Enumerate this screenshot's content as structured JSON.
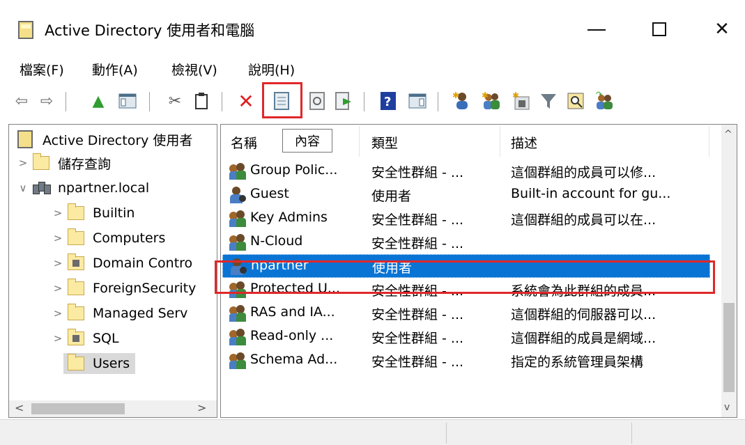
{
  "window": {
    "title": "Active Directory 使用者和電腦",
    "minimize": "—",
    "maximize": "☐",
    "close": "✕"
  },
  "menu": [
    {
      "label": "檔案(F)"
    },
    {
      "label": "動作(A)"
    },
    {
      "label": "檢視(V)"
    },
    {
      "label": "說明(H)"
    }
  ],
  "toolbar": {
    "icons": [
      "back-icon",
      "forward-icon",
      "up-folder-icon",
      "show-tree-icon",
      "cut-icon",
      "copy-icon",
      "delete-icon",
      "properties-icon",
      "refresh-icon",
      "export-list-icon",
      "help-icon",
      "action-pane-icon",
      "new-user-icon",
      "new-group-icon",
      "new-ou-icon",
      "filter-icon",
      "find-icon",
      "add-to-group-icon"
    ],
    "highlighted": "properties-icon",
    "highlight_color": "#e0282a"
  },
  "tree": {
    "root": "Active Directory 使用者",
    "items": [
      {
        "label": "儲存查詢"
      },
      {
        "label": "npartner.local"
      },
      {
        "label": "Builtin"
      },
      {
        "label": "Computers"
      },
      {
        "label": "Domain Contro"
      },
      {
        "label": "ForeignSecurity"
      },
      {
        "label": "Managed Serv"
      },
      {
        "label": "SQL"
      },
      {
        "label": "Users"
      }
    ],
    "selected": "Users"
  },
  "list": {
    "columns": {
      "name": "名稱",
      "type": "類型",
      "desc": "描述"
    },
    "tooltip": "內容",
    "rows": [
      {
        "name": "Group Polic...",
        "type": "安全性群組 - ...",
        "desc": "這個群組的成員可以修...",
        "icon": "group-icon"
      },
      {
        "name": "Guest",
        "type": "使用者",
        "desc": "Built-in account for gu...",
        "icon": "user-icon"
      },
      {
        "name": "Key Admins",
        "type": "安全性群組 - ...",
        "desc": "這個群組的成員可以在...",
        "icon": "group-icon"
      },
      {
        "name": "N-Cloud",
        "type": "安全性群組 - ...",
        "desc": "",
        "icon": "group-icon"
      },
      {
        "name": "npartner",
        "type": "使用者",
        "desc": "",
        "icon": "user-icon",
        "selected": true
      },
      {
        "name": "Protected U...",
        "type": "安全性群組 - ...",
        "desc": "系統會為此群組的成員...",
        "icon": "group-icon"
      },
      {
        "name": "RAS and IA...",
        "type": "安全性群組 - ...",
        "desc": "這個群組的伺服器可以...",
        "icon": "group-icon"
      },
      {
        "name": "Read-only ...",
        "type": "安全性群組 - ...",
        "desc": "這個群組的成員是網域...",
        "icon": "group-icon"
      },
      {
        "name": "Schema Ad...",
        "type": "安全性群組 - ...",
        "desc": "指定的系統管理員架構",
        "icon": "group-icon"
      }
    ],
    "selection_color": "#0a74d4"
  },
  "scroll": {
    "up": "^",
    "down": "v",
    "left": "<",
    "right": ">"
  }
}
